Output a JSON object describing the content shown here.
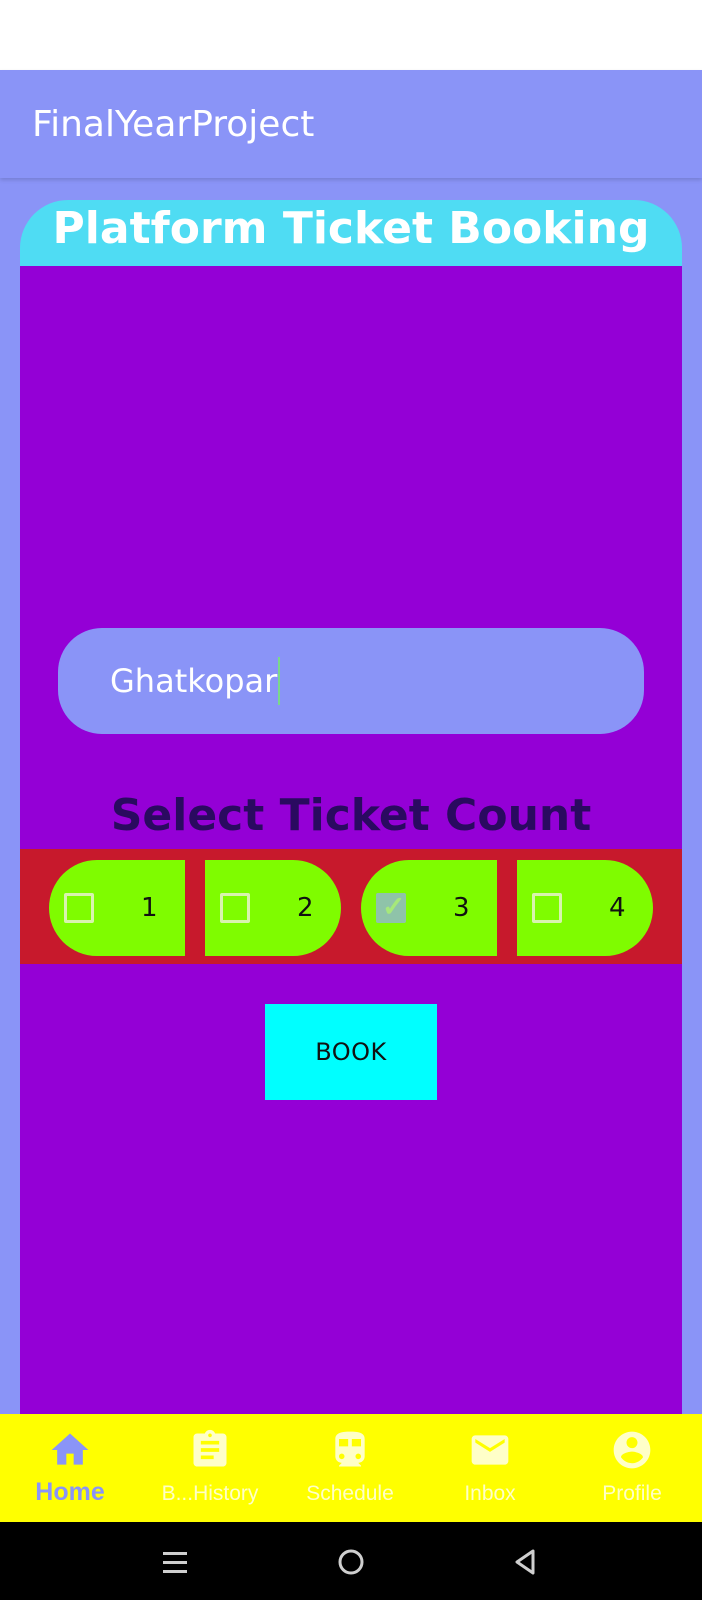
{
  "app_bar": {
    "title": "FinalYearProject"
  },
  "card": {
    "title": "Platform Ticket Booking"
  },
  "station_input": {
    "value": "Ghatkopar"
  },
  "ticket_count": {
    "heading": "Select Ticket Count",
    "options": [
      {
        "label": "1",
        "checked": false
      },
      {
        "label": "2",
        "checked": false
      },
      {
        "label": "3",
        "checked": true
      },
      {
        "label": "4",
        "checked": false
      }
    ]
  },
  "book_button": {
    "label": "BOOK"
  },
  "bottom_nav": {
    "items": [
      {
        "label": "Home",
        "icon": "home-icon",
        "active": true
      },
      {
        "label": "B...History",
        "icon": "clipboard-icon",
        "active": false
      },
      {
        "label": "Schedule",
        "icon": "train-icon",
        "active": false
      },
      {
        "label": "Inbox",
        "icon": "mail-icon",
        "active": false
      },
      {
        "label": "Profile",
        "icon": "account-icon",
        "active": false
      }
    ]
  },
  "colors": {
    "app_bar": "#8a94f7",
    "card_header": "#4fdcf3",
    "card_body": "#9400d6",
    "count_strip": "#c7192c",
    "option_bg": "#7ffc00",
    "book_button": "#00ffff",
    "bottom_nav": "#ffff00"
  }
}
